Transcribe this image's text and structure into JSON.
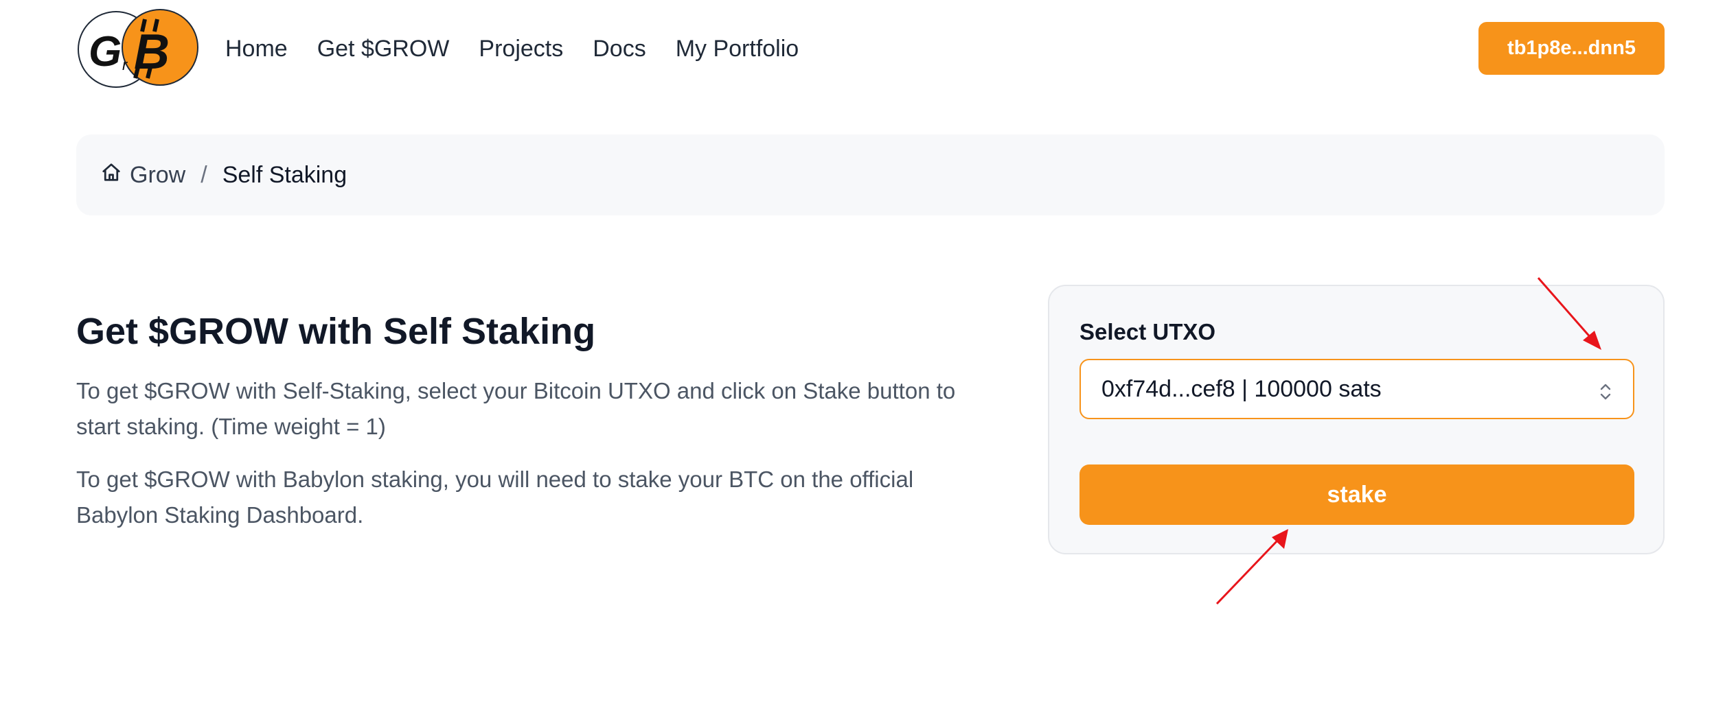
{
  "header": {
    "logo_text": "GrB",
    "nav": [
      {
        "label": "Home"
      },
      {
        "label": "Get $GROW"
      },
      {
        "label": "Projects"
      },
      {
        "label": "Docs"
      },
      {
        "label": "My Portfolio"
      }
    ],
    "wallet_label": "tb1p8e...dnn5"
  },
  "breadcrumb": {
    "home_label": "Grow",
    "separator": "/",
    "current": "Self Staking"
  },
  "main": {
    "title": "Get $GROW with Self Staking",
    "paragraph_1": "To get $GROW with Self-Staking, select your Bitcoin UTXO and click on Stake button to start staking. (Time weight = 1)",
    "paragraph_2": "To get $GROW with Babylon staking, you will need to stake your BTC on the official Babylon Staking Dashboard."
  },
  "card": {
    "select_label": "Select UTXO",
    "selected_utxo": "0xf74d...cef8 | 100000 sats",
    "stake_label": "stake"
  },
  "colors": {
    "accent": "#f7931a",
    "annotation": "#e8151b"
  }
}
